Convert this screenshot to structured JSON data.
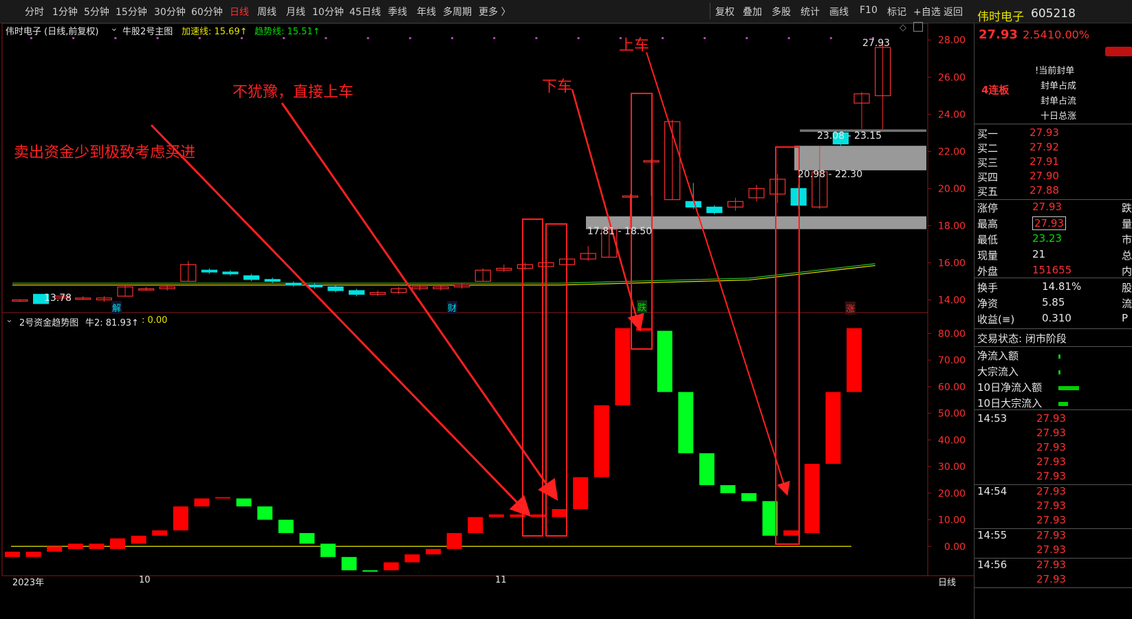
{
  "toolbar": {
    "left_items": [
      "分时",
      "1分钟",
      "5分钟",
      "15分钟",
      "30分钟",
      "60分钟",
      "日线",
      "周线",
      "月线",
      "10分钟",
      "45日线",
      "季线",
      "年线",
      "多周期",
      "更多 〉"
    ],
    "active_item": "日线",
    "right_items": [
      "复权",
      "叠加",
      "多股",
      "统计",
      "画线",
      "F10",
      "标记",
      "+自选",
      "返回"
    ]
  },
  "stock": {
    "name": "伟时电子",
    "code": "605218",
    "price": "27.93",
    "change": "2.54",
    "change_pct": "10.00%"
  },
  "main_chart": {
    "title": "伟时电子 (日线,前复权)",
    "indicator_name": "牛股2号主图",
    "accel_label": "加速线: 15.69↑",
    "trend_label": "趋势线: 15.51↑",
    "y_ticks": [
      "28.00",
      "26.00",
      "24.00",
      "22.00",
      "20.00",
      "18.00",
      "16.00",
      "14.00"
    ],
    "low_label": "13.78",
    "high_label": "27.93",
    "zone_upper": "23.08 - 23.15",
    "zone_mid": "20.98 - 22.30",
    "zone_low": "17.81 - 18.50",
    "markers": {
      "jie": "解",
      "cai": "财",
      "die": "跌",
      "zhang": "涨"
    }
  },
  "sub_chart": {
    "title": "2号资金趋势图",
    "value_label": "牛2: 81.93↑",
    "extra_label": ": 0.00",
    "y_ticks": [
      "80.00",
      "70.00",
      "60.00",
      "50.00",
      "40.00",
      "30.00",
      "20.00",
      "10.00",
      "0.00"
    ]
  },
  "x_axis": {
    "labels": [
      "2023年",
      "10",
      "11"
    ],
    "period": "日线"
  },
  "annotations": {
    "a1": "卖出资金少到极致考虑买进",
    "a2": "不犹豫，直接上车",
    "a3": "下车",
    "a4": "上车"
  },
  "right_panel": {
    "boards": "4连板",
    "seal_labels": [
      "!当前封单",
      "封单占成",
      "封单占流",
      "十日总涨"
    ],
    "bids": [
      {
        "label": "买一",
        "price": "27.93"
      },
      {
        "label": "买二",
        "price": "27.92"
      },
      {
        "label": "买三",
        "price": "27.91"
      },
      {
        "label": "买四",
        "price": "27.90"
      },
      {
        "label": "买五",
        "price": "27.88"
      }
    ],
    "stats": [
      {
        "label": "涨停",
        "value": "27.93",
        "extra": "跌",
        "color": "red"
      },
      {
        "label": "最高",
        "value": "27.93",
        "extra": "量",
        "color": "red"
      },
      {
        "label": "最低",
        "value": "23.23",
        "extra": "市",
        "color": "green"
      },
      {
        "label": "现量",
        "value": "21",
        "extra": "总",
        "color": "white"
      },
      {
        "label": "外盘",
        "value": "151655",
        "extra": "内",
        "color": "red"
      }
    ],
    "stats2": [
      {
        "label": "换手",
        "value": "14.81%",
        "extra": "股"
      },
      {
        "label": "净资",
        "value": "5.85",
        "extra": "流"
      },
      {
        "label": "收益(≡)",
        "value": "0.310",
        "extra": "P"
      }
    ],
    "trade_status": "交易状态: 闭市阶段",
    "flows": [
      "净流入额",
      "大宗流入",
      "10日净流入额",
      "10日大宗流入"
    ],
    "ticks": [
      {
        "time": "14:53",
        "prices": [
          "27.93",
          "27.93",
          "27.93",
          "27.93",
          "27.93"
        ]
      },
      {
        "time": "14:54",
        "prices": [
          "27.93",
          "27.93",
          "27.93"
        ]
      },
      {
        "time": "14:55",
        "prices": [
          "27.93",
          "27.93"
        ]
      },
      {
        "time": "14:56",
        "prices": [
          "27.93",
          "27.93"
        ]
      }
    ]
  },
  "chart_data": {
    "type": "candlestick",
    "price_candles": [
      {
        "o": 14.0,
        "c": 14.0,
        "h": 14.0,
        "l": 13.9
      },
      {
        "o": 14.3,
        "c": 13.8,
        "h": 14.3,
        "l": 13.78
      },
      {
        "o": 14.1,
        "c": 14.2,
        "h": 14.3,
        "l": 14.0
      },
      {
        "o": 14.1,
        "c": 14.1,
        "h": 14.2,
        "l": 14.0
      },
      {
        "o": 14.0,
        "c": 14.1,
        "h": 14.2,
        "l": 13.9
      },
      {
        "o": 14.2,
        "c": 14.7,
        "h": 14.8,
        "l": 14.2
      },
      {
        "o": 14.6,
        "c": 14.6,
        "h": 14.7,
        "l": 14.5
      },
      {
        "o": 14.6,
        "c": 14.7,
        "h": 14.8,
        "l": 14.5
      },
      {
        "o": 15.0,
        "c": 15.9,
        "h": 16.1,
        "l": 15.0
      },
      {
        "o": 15.6,
        "c": 15.5,
        "h": 15.7,
        "l": 15.4
      },
      {
        "o": 15.5,
        "c": 15.4,
        "h": 15.6,
        "l": 15.3
      },
      {
        "o": 15.3,
        "c": 15.1,
        "h": 15.4,
        "l": 15.0
      },
      {
        "o": 15.1,
        "c": 15.0,
        "h": 15.2,
        "l": 14.9
      },
      {
        "o": 14.9,
        "c": 14.8,
        "h": 15.0,
        "l": 14.7
      },
      {
        "o": 14.8,
        "c": 14.7,
        "h": 14.9,
        "l": 14.6
      },
      {
        "o": 14.7,
        "c": 14.5,
        "h": 14.8,
        "l": 14.4
      },
      {
        "o": 14.5,
        "c": 14.3,
        "h": 14.6,
        "l": 14.2
      },
      {
        "o": 14.3,
        "c": 14.4,
        "h": 14.5,
        "l": 14.2
      },
      {
        "o": 14.4,
        "c": 14.6,
        "h": 14.7,
        "l": 14.3
      },
      {
        "o": 14.6,
        "c": 14.7,
        "h": 14.8,
        "l": 14.5
      },
      {
        "o": 14.6,
        "c": 14.7,
        "h": 14.8,
        "l": 14.5
      },
      {
        "o": 14.7,
        "c": 14.8,
        "h": 14.9,
        "l": 14.6
      },
      {
        "o": 15.0,
        "c": 15.6,
        "h": 15.7,
        "l": 15.0
      },
      {
        "o": 15.6,
        "c": 15.7,
        "h": 15.9,
        "l": 15.5
      },
      {
        "o": 15.7,
        "c": 15.9,
        "h": 16.0,
        "l": 15.6
      },
      {
        "o": 15.8,
        "c": 16.0,
        "h": 16.1,
        "l": 15.8
      },
      {
        "o": 15.9,
        "c": 16.2,
        "h": 16.3,
        "l": 15.8
      },
      {
        "o": 16.2,
        "c": 16.5,
        "h": 16.9,
        "l": 16.1
      },
      {
        "o": 16.3,
        "c": 17.8,
        "h": 17.9,
        "l": 16.3
      },
      {
        "o": 19.6,
        "c": 19.6,
        "h": 19.7,
        "l": 17.9
      },
      {
        "o": 21.5,
        "c": 21.5,
        "h": 21.6,
        "l": 19.6
      },
      {
        "o": 19.4,
        "c": 23.6,
        "h": 23.7,
        "l": 19.4
      },
      {
        "o": 19.3,
        "c": 19.0,
        "h": 20.3,
        "l": 18.9
      },
      {
        "o": 19.0,
        "c": 18.7,
        "h": 19.1,
        "l": 18.6
      },
      {
        "o": 19.0,
        "c": 19.3,
        "h": 19.5,
        "l": 18.8
      },
      {
        "o": 19.5,
        "c": 20.0,
        "h": 20.2,
        "l": 19.3
      },
      {
        "o": 19.7,
        "c": 20.5,
        "h": 20.8,
        "l": 19.2
      },
      {
        "o": 20.0,
        "c": 19.1,
        "h": 20.2,
        "l": 18.9
      },
      {
        "o": 19.0,
        "c": 20.9,
        "h": 22.3,
        "l": 18.9
      },
      {
        "o": 23.0,
        "c": 22.4,
        "h": 23.1,
        "l": 22.3
      },
      {
        "o": 24.6,
        "c": 25.1,
        "h": 25.2,
        "l": 23.2
      },
      {
        "o": 25.0,
        "c": 27.6,
        "h": 27.93,
        "l": 23.2
      }
    ],
    "fund_bars": [
      {
        "o": -4,
        "c": -2
      },
      {
        "o": -4,
        "c": -2
      },
      {
        "o": -2,
        "c": 0
      },
      {
        "o": -1,
        "c": 1
      },
      {
        "o": -1,
        "c": 1
      },
      {
        "o": -1,
        "c": 3
      },
      {
        "o": 1,
        "c": 4
      },
      {
        "o": 4,
        "c": 6
      },
      {
        "o": 6,
        "c": 15
      },
      {
        "o": 15,
        "c": 18
      },
      {
        "o": 18,
        "c": 18.5
      },
      {
        "o": 18,
        "c": 15
      },
      {
        "o": 15,
        "c": 10
      },
      {
        "o": 10,
        "c": 5
      },
      {
        "o": 5,
        "c": 1
      },
      {
        "o": 1,
        "c": -4
      },
      {
        "o": -4,
        "c": -9
      },
      {
        "o": -9,
        "c": -9.5
      },
      {
        "o": -9,
        "c": -6
      },
      {
        "o": -6,
        "c": -3
      },
      {
        "o": -3,
        "c": -1
      },
      {
        "o": -1,
        "c": 5
      },
      {
        "o": 5,
        "c": 11
      },
      {
        "o": 11,
        "c": 12
      },
      {
        "o": 11,
        "c": 12
      },
      {
        "o": 11,
        "c": 12
      },
      {
        "o": 11,
        "c": 14
      },
      {
        "o": 14,
        "c": 26
      },
      {
        "o": 26,
        "c": 53
      },
      {
        "o": 53,
        "c": 82
      },
      {
        "o": 81,
        "c": 82
      },
      {
        "o": 81,
        "c": 58
      },
      {
        "o": 58,
        "c": 35
      },
      {
        "o": 35,
        "c": 23
      },
      {
        "o": 23,
        "c": 20
      },
      {
        "o": 20,
        "c": 17
      },
      {
        "o": 17,
        "c": 4
      },
      {
        "o": 4,
        "c": 6
      },
      {
        "o": 5,
        "c": 31
      },
      {
        "o": 31,
        "c": 58
      },
      {
        "o": 58,
        "c": 82
      }
    ],
    "ylim_price": [
      13.5,
      28.6
    ],
    "ylim_fund": [
      -10,
      85
    ]
  }
}
